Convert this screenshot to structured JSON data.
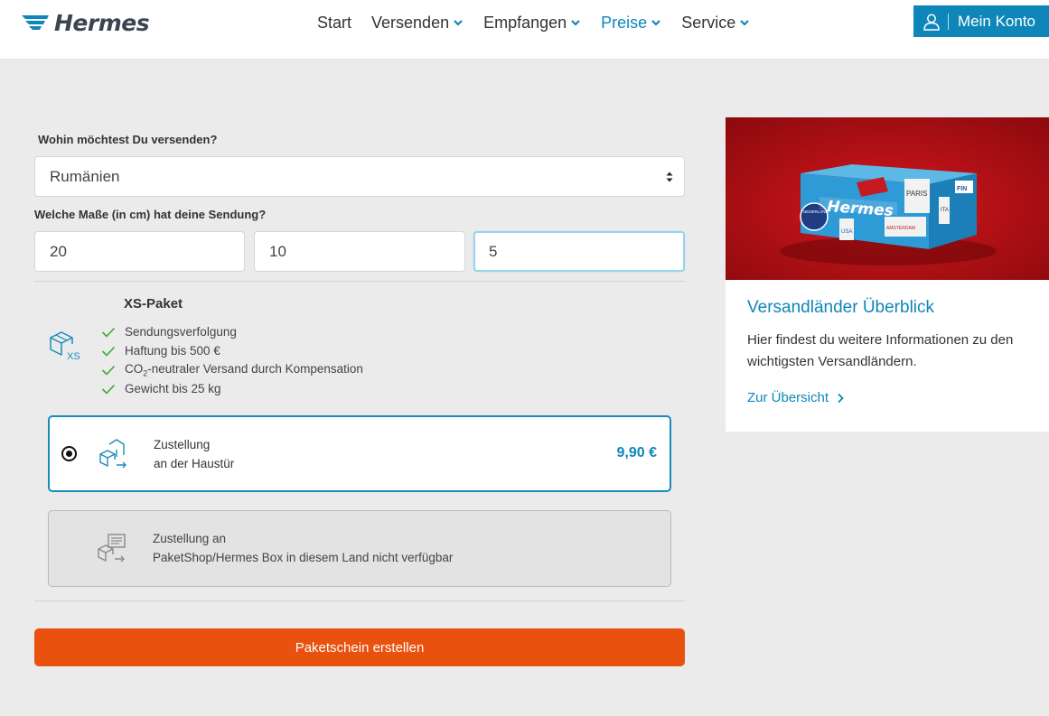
{
  "brand": {
    "logo_text": "Hermes",
    "accent": "#0f86b9",
    "cta_color": "#e8520e"
  },
  "nav": {
    "items": [
      {
        "label": "Start",
        "dropdown": false,
        "active": false
      },
      {
        "label": "Versenden",
        "dropdown": true,
        "active": false
      },
      {
        "label": "Empfangen",
        "dropdown": true,
        "active": false
      },
      {
        "label": "Preise",
        "dropdown": true,
        "active": true
      },
      {
        "label": "Service",
        "dropdown": true,
        "active": false
      }
    ],
    "account_label": "Mein Konto"
  },
  "form": {
    "destination_label": "Wohin möchtest Du versenden?",
    "destination_value": "Rumänien",
    "dimensions_label": "Welche Maße (in cm) hat deine Sendung?",
    "dimensions": [
      "20",
      "10",
      "5"
    ]
  },
  "package": {
    "icon_label": "XS",
    "title": "XS-Paket",
    "features": [
      "Sendungsverfolgung",
      "Haftung bis 500 €",
      "CO",
      "2",
      "-neutraler Versand durch Kompensation",
      "Gewicht bis 25 kg"
    ],
    "options": [
      {
        "line1": "Zustellung",
        "line2": "an der Haustür",
        "price": "9,90 €",
        "selected": true
      },
      {
        "line1": "Zustellung an",
        "line2": "PaketShop/Hermes Box in diesem Land nicht verfügbar",
        "selected": false,
        "disabled": true
      }
    ]
  },
  "cta": {
    "label": "Paketschein erstellen"
  },
  "card": {
    "title": "Versandländer Überblick",
    "text": "Hier findest du weitere Informationen zu den wichtigsten Versandländern.",
    "link": "Zur Übersicht",
    "box_brand": "Hermes",
    "box_stickers": [
      "PARIS",
      "FIN",
      "ITA",
      "NEDERLAND",
      "AMSTERDAM",
      "USA"
    ]
  }
}
